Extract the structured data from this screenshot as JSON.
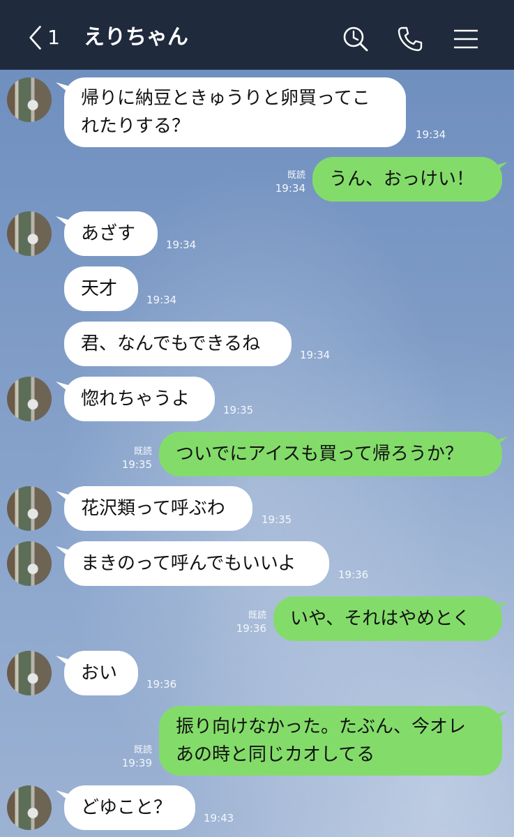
{
  "header": {
    "back_count": "1",
    "title": "えりちゃん",
    "icons": [
      "back-chevron-icon",
      "search-icon",
      "phone-icon",
      "menu-icon"
    ]
  },
  "colors": {
    "header_bg": "#1f2a3c",
    "chat_bg": "#7f9cc4",
    "incoming_bubble": "#ffffff",
    "outgoing_bubble": "#83dc6a"
  },
  "read_label": "既読",
  "messages": [
    {
      "dir": "in",
      "text_lines": [
        "帰りに納豆ときゅうりと卵買ってこ",
        "れたりする？"
      ],
      "time": "19:34"
    },
    {
      "dir": "out",
      "text": "うん、おっけい！",
      "read": "既読",
      "time": "19:34"
    },
    {
      "dir": "in",
      "text": "あざす",
      "time": "19:34"
    },
    {
      "dir": "in",
      "text": "天才",
      "time": "19:34"
    },
    {
      "dir": "in",
      "text": "君、なんでもできるね",
      "time": "19:34"
    },
    {
      "dir": "in",
      "text": "惚れちゃうよ",
      "time": "19:35"
    },
    {
      "dir": "out",
      "text": "ついでにアイスも買って帰ろうか？",
      "read": "既読",
      "time": "19:35"
    },
    {
      "dir": "in",
      "text": "花沢類って呼ぶわ",
      "time": "19:35"
    },
    {
      "dir": "in",
      "text": "まきのって呼んでもいいよ",
      "time": "19:36"
    },
    {
      "dir": "out",
      "text": "いや、それはやめとく",
      "read": "既読",
      "time": "19:36"
    },
    {
      "dir": "in",
      "text": "おい",
      "time": "19:36"
    },
    {
      "dir": "out",
      "text_lines": [
        "振り向けなかった。たぶん、今オレ",
        "あの時と同じカオしてる"
      ],
      "read": "既読",
      "time": "19:39"
    },
    {
      "dir": "in",
      "text": "どゆこと？",
      "time": "19:43"
    }
  ]
}
